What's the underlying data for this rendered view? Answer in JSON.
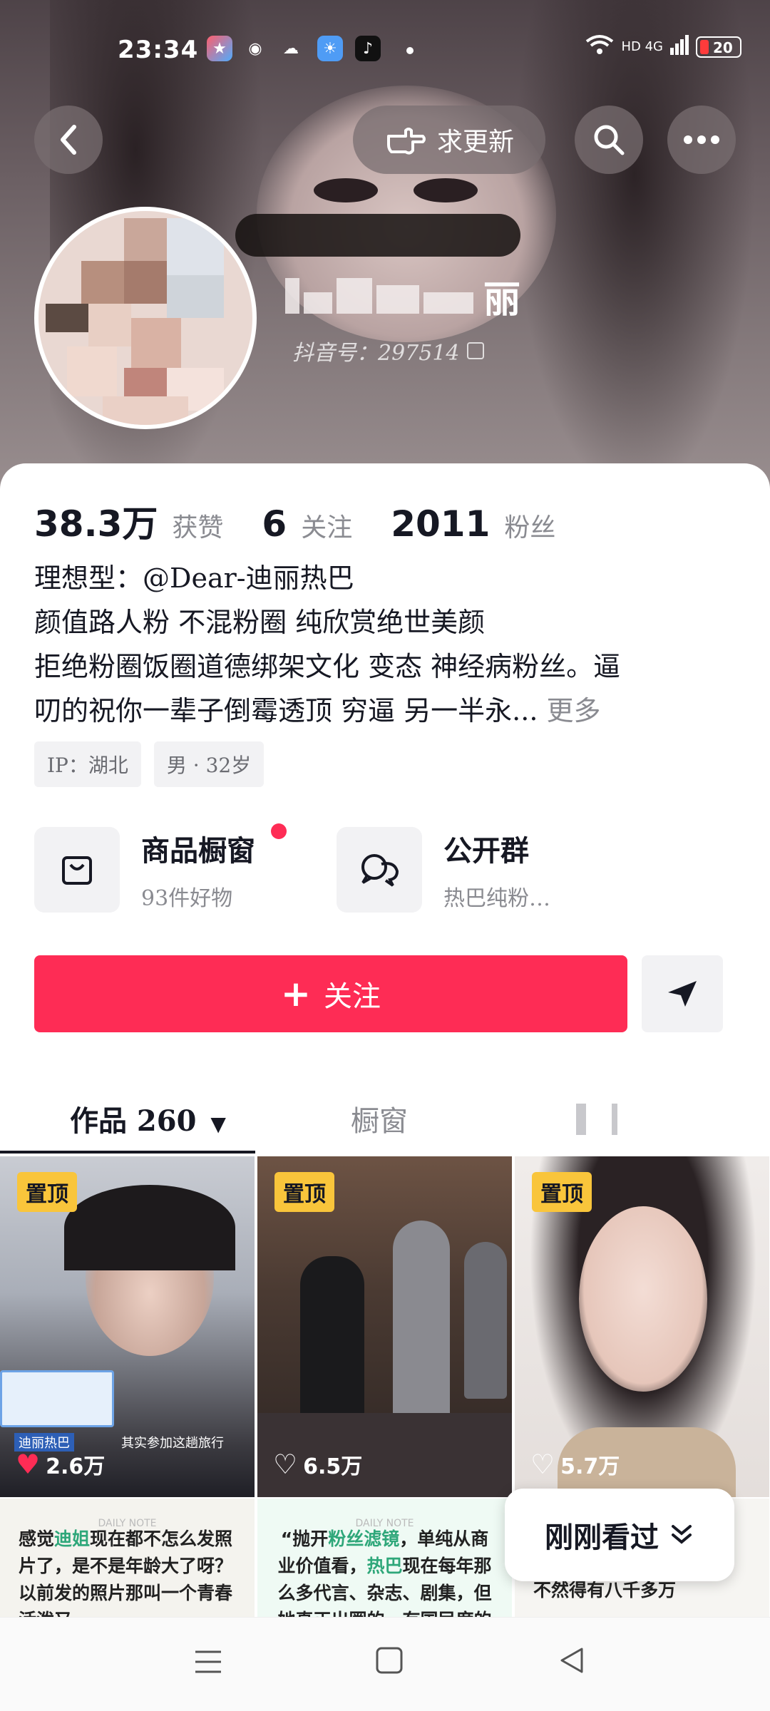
{
  "status_bar": {
    "time": "23:34",
    "network": "HD 4G",
    "battery": "20"
  },
  "header": {
    "request_update_label": "求更新"
  },
  "profile": {
    "name_visible_suffix": "丽",
    "douyin_id": "抖音号：297514"
  },
  "stats": [
    {
      "num": "38.3万",
      "label": "获赞"
    },
    {
      "num": "6",
      "label": "关注"
    },
    {
      "num": "2011",
      "label": "粉丝"
    }
  ],
  "bio": {
    "line1": "理想型：@Dear-迪丽热巴",
    "line2": "颜值路人粉 不混粉圈 纯欣赏绝世美颜",
    "line3": "拒绝粉圈饭圈道德绑架文化 变态 神经病粉丝。逼",
    "line4": "叨的祝你一辈子倒霉透顶 穷逼 另一半永...",
    "more": "更多"
  },
  "tags": [
    "IP：湖北",
    "男 · 32岁"
  ],
  "entries": [
    {
      "title": "商品橱窗",
      "sub": "93件好物"
    },
    {
      "title": "公开群",
      "sub": "热巴纯粉…"
    }
  ],
  "follow": {
    "label": "关注"
  },
  "tabs": {
    "works": "作品 260",
    "window": "橱窗"
  },
  "tiles": [
    {
      "pin": "置顶",
      "likes": "2.6万",
      "caption": "迪丽热巴",
      "subcaption": "其实参加这趟旅行"
    },
    {
      "pin": "置顶",
      "likes": "6.5万"
    },
    {
      "pin": "置顶",
      "likes": "5.7万"
    }
  ],
  "notes": [
    {
      "header": "DAILY NOTE",
      "text_a": "感觉",
      "hl_a": "迪姐",
      "text_b": "现在都不怎么发照片了，是不是年龄大了呀？以前发的照片那叫一个青春活泼又"
    },
    {
      "header": "DAILY NOTE",
      "text_a": "“抛开",
      "hl_a": "粉丝滤镜",
      "text_b": "，单纯从商业价值看，",
      "hl_b": "热巴",
      "text_c": "现在每年那么多代言、杂志、剧集，但她真正出圈的、有国民度的作品"
    },
    {
      "header": "",
      "text_a": "不然得有八千多万"
    }
  ],
  "recently_viewed": "刚刚看过"
}
